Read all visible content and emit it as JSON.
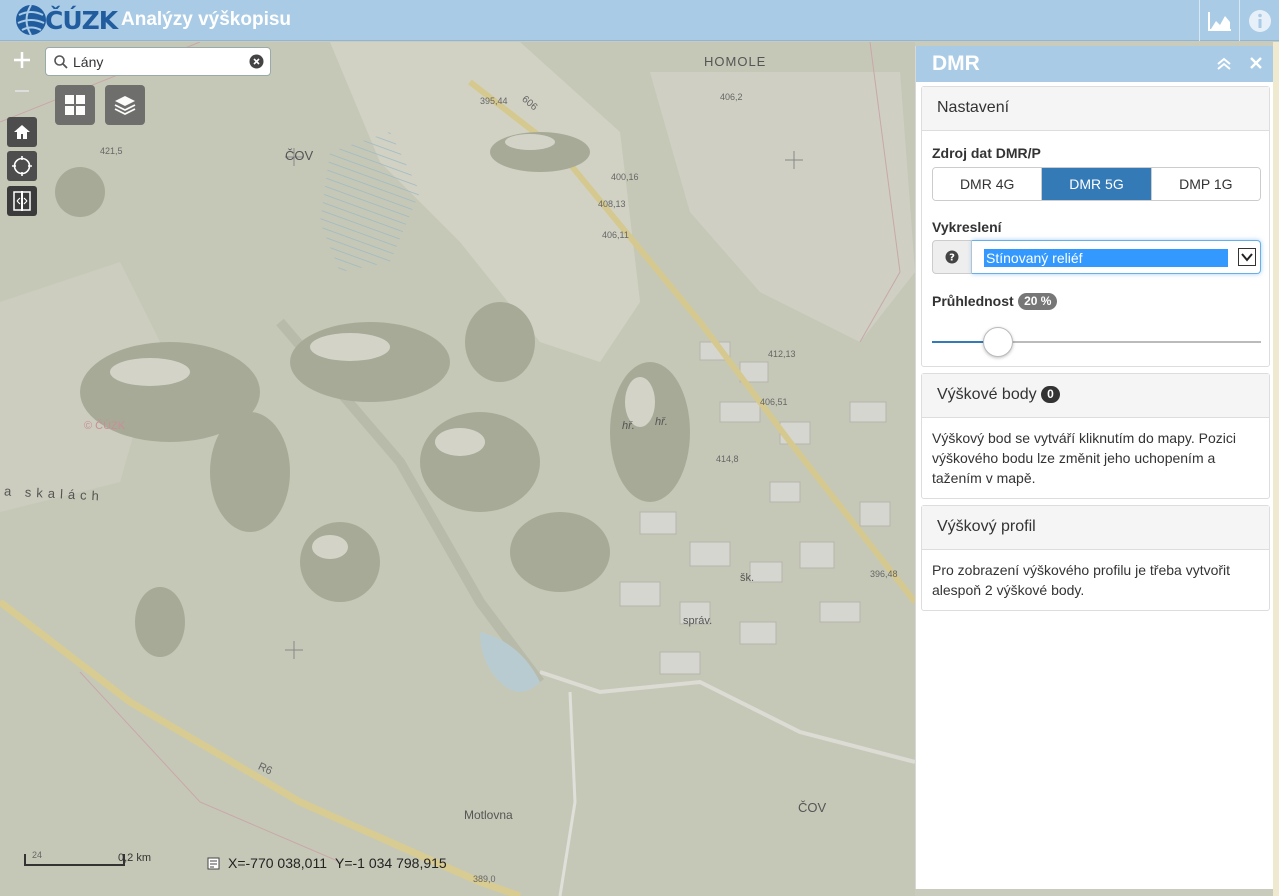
{
  "header": {
    "logo_text": "ČÚZK",
    "title": "Analýzy výškopisu",
    "right_icons": [
      "chart-area-icon",
      "info-icon"
    ]
  },
  "map": {
    "search": {
      "value": "Lány",
      "icons": [
        "search-icon",
        "clear-icon"
      ]
    },
    "tools": [
      "zoom-in-icon",
      "zoom-out-icon",
      "home-icon",
      "locate-icon",
      "compare-icon",
      "grid-icon",
      "layers-icon"
    ],
    "labels": {
      "homole": "HOMOLE",
      "cov1": "ČOV",
      "cov2": "ČOV",
      "skalach": "a skalách",
      "motlovna": "Motlovna",
      "cuzk_wm": "© ČÚZK",
      "r6": "R6",
      "road606": "606",
      "h395": "395,44",
      "h400": "400,16",
      "h408": "408,13",
      "h406": "406,11",
      "h412": "412,13",
      "h406b": "406,51",
      "h414": "414,8",
      "h421": "421,5",
      "h396": "396,48",
      "h406c": "406,2",
      "hl1": "hř.",
      "hl2": "hř.",
      "sk": "šk.",
      "sprav": "správ.",
      "h24": "24",
      "h389": "389,0"
    },
    "scale_label": "0,2 km",
    "coords": {
      "x": "X=-770 038,011",
      "y": "Y=-1 034 798,915"
    }
  },
  "panel": {
    "title": "DMR",
    "settings": {
      "heading": "Nastavení",
      "source_label": "Zdroj dat DMR/P",
      "source_options": [
        "DMR 4G",
        "DMR 5G",
        "DMP 1G"
      ],
      "source_selected": "DMR 5G",
      "render_label": "Vykreslení",
      "render_value": "Stínovaný reliéf",
      "opacity_label": "Průhlednost",
      "opacity_badge": "20 %",
      "opacity_value": 0.2
    },
    "points": {
      "heading": "Výškové body",
      "count": "0",
      "text": "Výškový bod se vytváří kliknutím do mapy. Pozici výškového bodu lze změnit jeho uchopením a tažením v mapě."
    },
    "profile": {
      "heading": "Výškový profil",
      "text": "Pro zobrazení výškového profilu je třeba vytvořit alespoň 2 výškové body."
    }
  },
  "colors": {
    "header": "#a9cbe6",
    "accent": "#337ab7",
    "map_base": "#c8cabb"
  }
}
